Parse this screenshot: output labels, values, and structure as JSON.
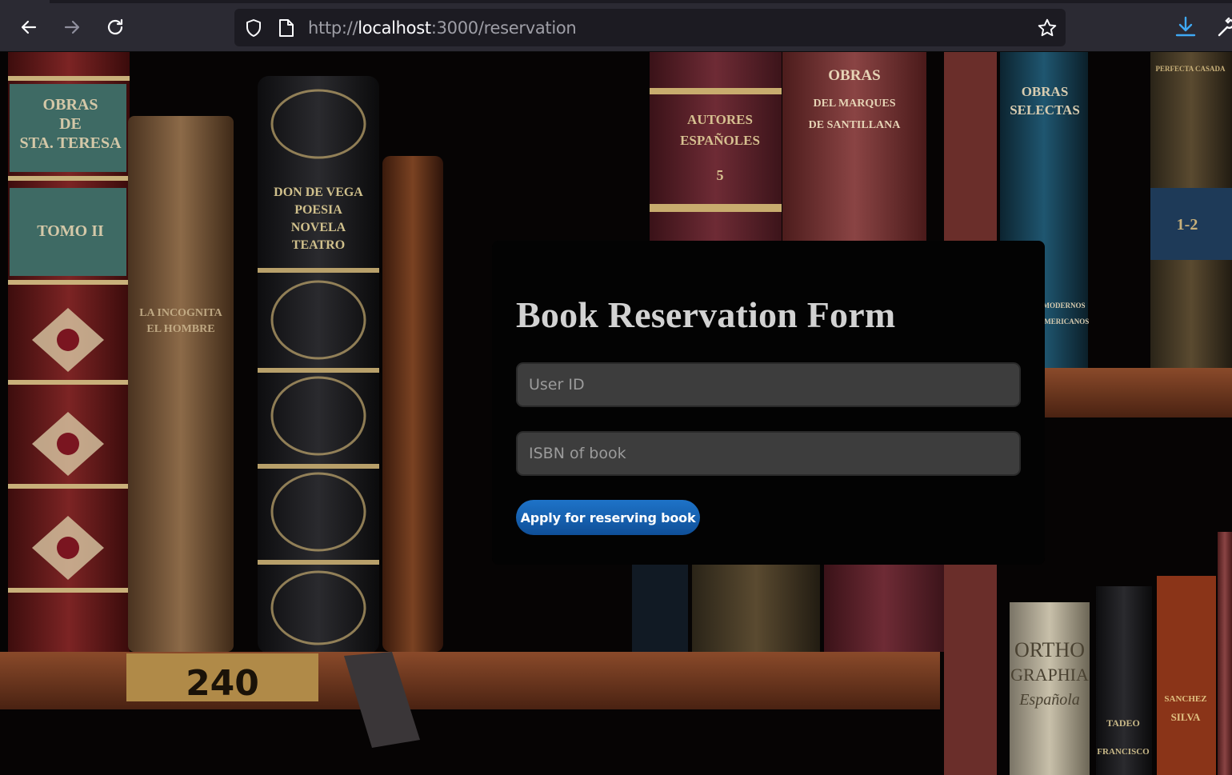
{
  "browser": {
    "url_scheme": "http://",
    "url_host": "localhost",
    "url_path": ":3000/reservation",
    "icons": [
      "back-icon",
      "forward-icon",
      "reload-icon",
      "shield-icon",
      "page-icon",
      "star-icon",
      "download-icon",
      "wrench-icon"
    ],
    "accent_color": "#3fa9f5"
  },
  "background": {
    "description_colors": [
      "#6b2222",
      "#1b3e52",
      "#5a3a1e",
      "#7a4a28"
    ],
    "shelf_label": "240",
    "spine_texts": {
      "teresa": [
        "OBRAS",
        "DE",
        "STA. TERESA"
      ],
      "tomo": [
        "TOMO II"
      ],
      "incognita": [
        "LA INCOGNITA",
        "EL HOMBRE"
      ],
      "poesia": [
        "DON DE VEGA",
        "POESIA",
        "NOVELA",
        "TEATRO"
      ],
      "autores": [
        "AUTORES",
        "ESPAÑOLES",
        "5"
      ],
      "marques": [
        "OBRAS",
        "DEL MARQUES",
        "DE SANTILLANA"
      ],
      "selectas": [
        "OBRAS",
        "SELECTAS"
      ],
      "modernos": [
        "MODERNOS",
        "AMERICANOS"
      ],
      "perfecta": [
        "PERFECTA CASADA",
        "1-2"
      ],
      "ortho": [
        "ORTHO",
        "GRAPHIA",
        "Española"
      ],
      "tadeo": [
        "TADEO",
        "FRANCISCO"
      ],
      "sanchez": [
        "SANCHEZ",
        "SILVA"
      ]
    }
  },
  "form": {
    "title": "Book Reservation Form",
    "user_id_placeholder": "User ID",
    "user_id_value": "",
    "isbn_placeholder": "ISBN of book",
    "isbn_value": "",
    "submit_label": "Apply for reserving book",
    "button_color": "#1a66b8"
  }
}
